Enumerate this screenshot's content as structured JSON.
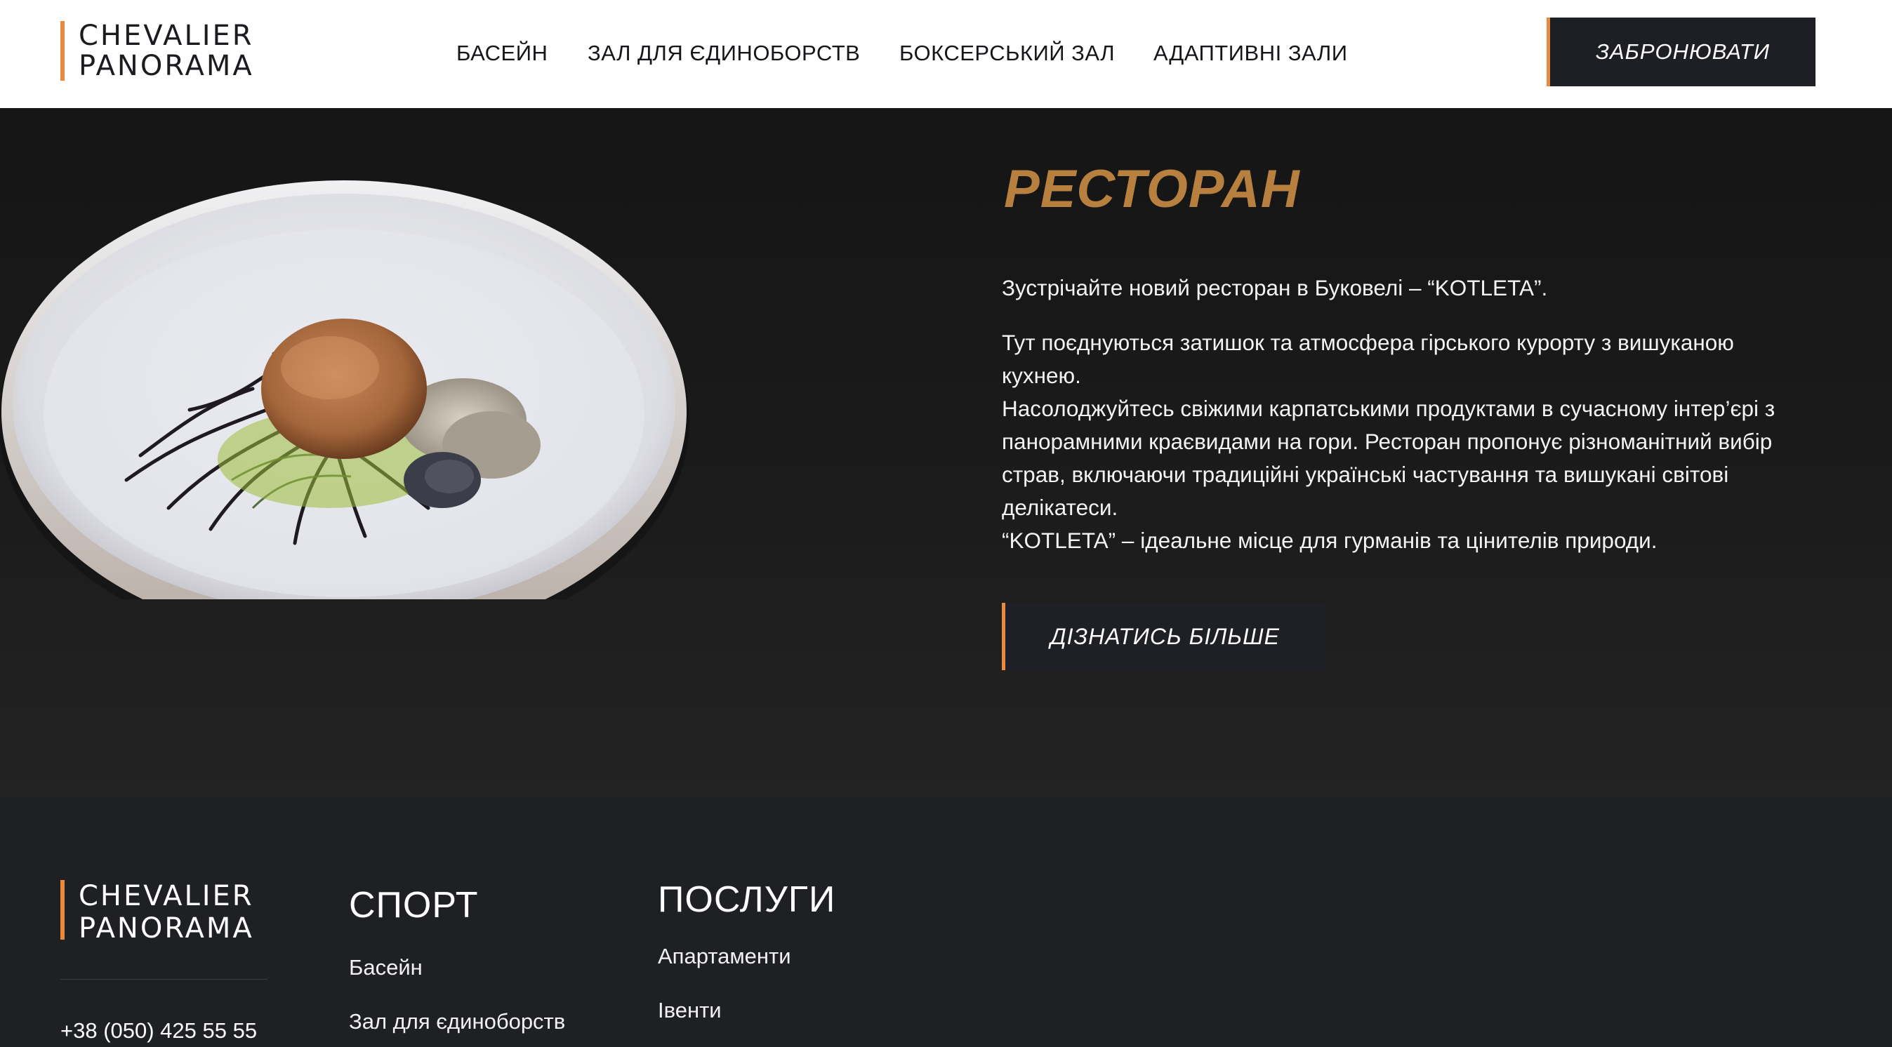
{
  "header": {
    "logo_line1": "CHEVALIER",
    "logo_line2": "PANORAMA",
    "nav": [
      "БАСЕЙН",
      "ЗАЛ ДЛЯ ЄДИНОБОРСТВ",
      "БОКСЕРСЬКИЙ ЗАЛ",
      "АДАПТИВНІ ЗАЛИ"
    ],
    "book_label": "ЗАБРОНЮВАТИ"
  },
  "section": {
    "title": "РЕСТОРАН",
    "intro": "Зустрічайте новий ресторан в Буковелі – “KOTLETA”.",
    "lines": [
      "Тут поєднуються затишок та атмосфера гірського курорту з вишуканою кухнею.",
      "Насолоджуйтесь свіжими карпатськими продуктами в сучасному інтер’єрі з панорамними краєвидами на гори. Ресторан пропонує різноманітний вибір страв, включаючи традиційні українські частування та вишукані світові делікатеси.",
      "“KOTLETA” – ідеальне місце для гурманів та цінителів природи."
    ],
    "button_label": "ДІЗНАТИСЬ БІЛЬШЕ"
  },
  "footer": {
    "logo_line1": "CHEVALIER",
    "logo_line2": "PANORAMA",
    "phone": "+38 (050) 425 55 55",
    "sport": {
      "title": "СПОРТ",
      "links": [
        "Басейн",
        "Зал для єдиноборств"
      ]
    },
    "services": {
      "title": "ПОСЛУГИ",
      "links": [
        "Апартаменти",
        "Івенти"
      ]
    }
  },
  "colors": {
    "accent": "#e98a3f",
    "title": "#b8803f",
    "dark": "#1e2024"
  }
}
